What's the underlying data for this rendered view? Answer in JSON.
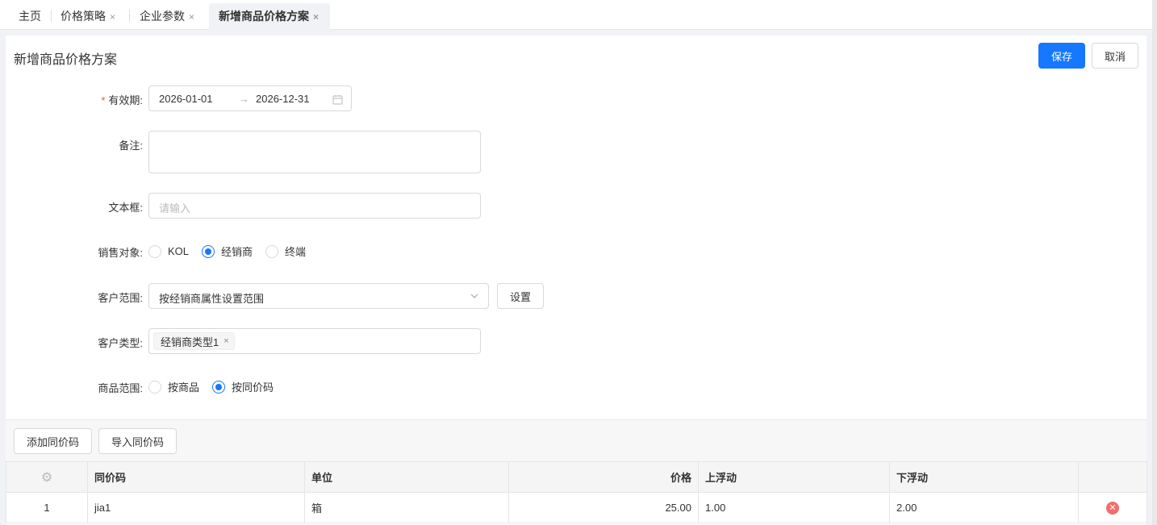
{
  "tabs": [
    {
      "label": "主页"
    },
    {
      "label": "价格策略",
      "close": "×"
    },
    {
      "label": "企业参数",
      "close": "×"
    },
    {
      "label": "新增商品价格方案",
      "close": "×"
    }
  ],
  "header": {
    "title": "新增商品价格方案",
    "save_label": "保存",
    "cancel_label": "取消"
  },
  "form": {
    "validity": {
      "label": "有效期:",
      "start": "2026-01-01",
      "arrow": "→",
      "end": "2026-12-31"
    },
    "remark": {
      "label": "备注:",
      "value": ""
    },
    "textbox": {
      "label": "文本框:",
      "placeholder": "请输入"
    },
    "sales_target": {
      "label": "销售对象:",
      "options": [
        "KOL",
        "经销商",
        "终端"
      ],
      "selected": "经销商"
    },
    "customer_range": {
      "label": "客户范围:",
      "value": "按经销商属性设置范围",
      "settings_label": "设置"
    },
    "customer_type": {
      "label": "客户类型:",
      "tags": [
        "经销商类型1"
      ]
    },
    "product_range": {
      "label": "商品范围:",
      "options": [
        "按商品",
        "按同价码"
      ],
      "selected": "按同价码"
    }
  },
  "toolbar": {
    "add_label": "添加同价码",
    "import_label": "导入同价码"
  },
  "table": {
    "columns": [
      "同价码",
      "单位",
      "价格",
      "上浮动",
      "下浮动"
    ],
    "rows": [
      {
        "index": "1",
        "code": "jia1",
        "unit": "箱",
        "price": "25.00",
        "up": "1.00",
        "down": "2.00"
      }
    ]
  },
  "colors": {
    "primary": "#1677ff",
    "danger": "#f56c6c",
    "required": "#ff4d4f"
  }
}
